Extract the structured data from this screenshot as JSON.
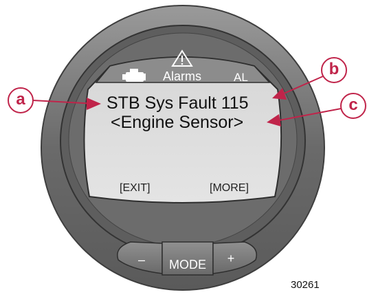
{
  "display": {
    "header": {
      "title": "Alarms",
      "code": "AL",
      "engine_icon": "engine-icon",
      "warning_icon": "warning-triangle-icon"
    },
    "fault_line": "STB Sys Fault 115",
    "fault_detail": "<Engine Sensor>",
    "softkeys": {
      "exit": "[EXIT]",
      "more": "[MORE]"
    }
  },
  "buttons": {
    "minus": "–",
    "mode": "MODE",
    "plus": "+"
  },
  "callouts": {
    "a": "a",
    "b": "b",
    "c": "c"
  },
  "figure_number": "30261",
  "colors": {
    "callout": "#c0244a",
    "screen": "#dcdcdc",
    "header_bar": "#8a8a8a",
    "bezel_outer": "#6e6e6e",
    "bezel_inner": "#565656",
    "buttons": "#777777"
  }
}
